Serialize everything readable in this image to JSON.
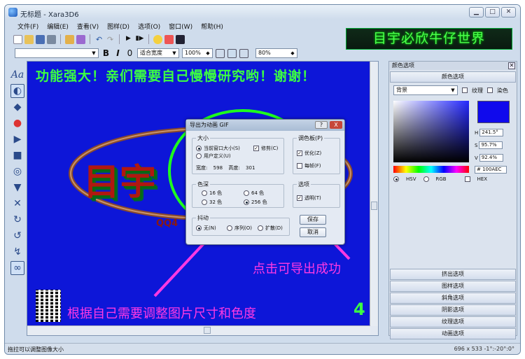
{
  "window": {
    "title": "无标题 - Xara3D6"
  },
  "menu": [
    "文件(F)",
    "编辑(E)",
    "查看(V)",
    "图样(D)",
    "选项(O)",
    "窗口(W)",
    "帮助(H)"
  ],
  "banner": "目宇必欣牛仔世界",
  "toolbar2": {
    "fit_label": "适合宽度",
    "zoom1": "100%",
    "zoom2": "80%",
    "font_buttons": [
      "B",
      "I",
      "0"
    ]
  },
  "canvas": {
    "top_text": "功能强大！亲们需要自己慢慢研究哟！谢谢！",
    "save_note": "点击可导出成功",
    "adjust_note": "根据自己需要调整图片尺寸和色度",
    "step_number": "4",
    "logo_text": "目宇",
    "logo_sub": "QQ4",
    "aa_label": "Aa"
  },
  "dialog": {
    "title": "导出为动画 GIF",
    "help": "?",
    "close": "X",
    "size_group": "大小",
    "size_current": "当前窗口大小(S)",
    "size_custom": "用户定义(U)",
    "crop": "修剪(C)",
    "width_label": "宽度:",
    "width_value": "598",
    "height_label": "高度:",
    "height_value": "301",
    "palette_group": "调色板(P)",
    "optimize": "优化(Z)",
    "per_frame": "每帧(F)",
    "depth_group": "色深",
    "d16": "16 色",
    "d64": "64 色",
    "d32": "32 色",
    "d256": "256 色",
    "options_group": "选项",
    "transparent": "透明(T)",
    "dither_group": "抖动",
    "dither_none": "无(N)",
    "dither_order": "序列(O)",
    "dither_diffuse": "扩散(D)",
    "save": "保存",
    "cancel": "取消"
  },
  "panel": {
    "title": "颜色选项",
    "tab": "颜色选项",
    "bg_select": "背景",
    "texture": "纹理",
    "dye": "染色",
    "h": "241.5°",
    "s": "95.7%",
    "v": "92.4%",
    "hex": "# 100AEC",
    "modes": [
      "HSV",
      "RGB",
      "HEX"
    ],
    "bottom_tabs": [
      "挤出选项",
      "图样选项",
      "斜角选项",
      "阴影选项",
      "纹理选项",
      "动画选项"
    ]
  },
  "status": {
    "left": "拖拉可以调整图像大小",
    "right": "696 x 533  -1°:-20°:0°"
  },
  "colors": {
    "canvas_bg": "#0d16d8",
    "ring": "#1eff1e",
    "note": "#ff39e3"
  }
}
